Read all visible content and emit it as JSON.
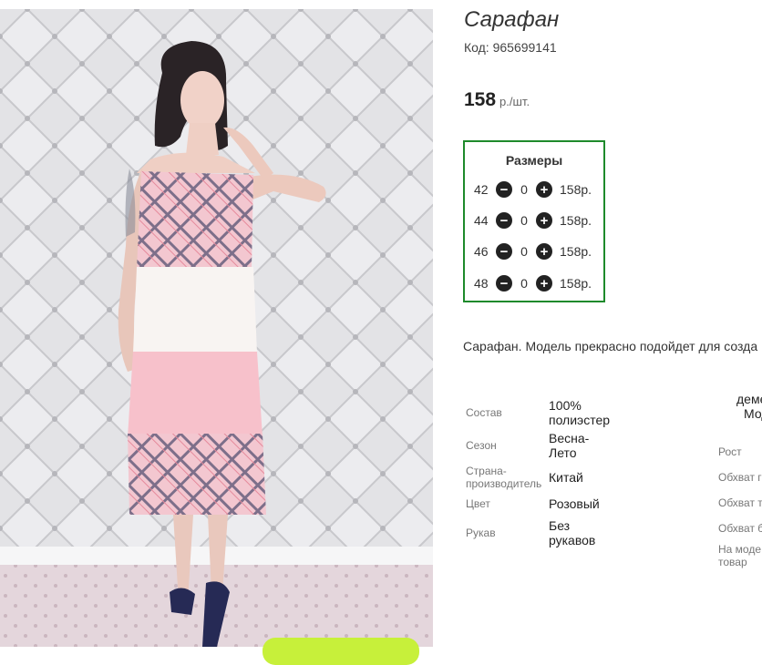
{
  "product": {
    "title": "Сарафан",
    "code": "Код: 965699141",
    "price": "158",
    "price_unit": "р./шт.",
    "description": "Сарафан. Модель прекрасно подойдет для созда"
  },
  "sizes": {
    "heading": "Размеры",
    "rows": [
      {
        "size": "42",
        "qty": "0",
        "price": "158р."
      },
      {
        "size": "44",
        "qty": "0",
        "price": "158р."
      },
      {
        "size": "46",
        "qty": "0",
        "price": "158р."
      },
      {
        "size": "48",
        "qty": "0",
        "price": "158р."
      }
    ]
  },
  "attributes": [
    {
      "label": "Состав",
      "value": "100% полиэстер"
    },
    {
      "label": "Сезон",
      "value": "Весна-Лето"
    },
    {
      "label": "Страна-производитель",
      "value": "Китай"
    },
    {
      "label": "Цвет",
      "value": "Розовый"
    },
    {
      "label": "Рукав",
      "value": "Без рукавов"
    }
  ],
  "right_column": {
    "top_value_1": "деме",
    "top_value_2": "Мод",
    "labels": [
      "Рост",
      "Обхват гр",
      "Обхват т",
      "Обхват б",
      "На моде",
      "товар"
    ]
  },
  "colors": {
    "sizes_border": "#1e8a2b",
    "button_green": "#c7f03a",
    "dress_pink": "#f4b9c4"
  },
  "icons": [
    "minus-circle-icon",
    "plus-circle-icon"
  ]
}
